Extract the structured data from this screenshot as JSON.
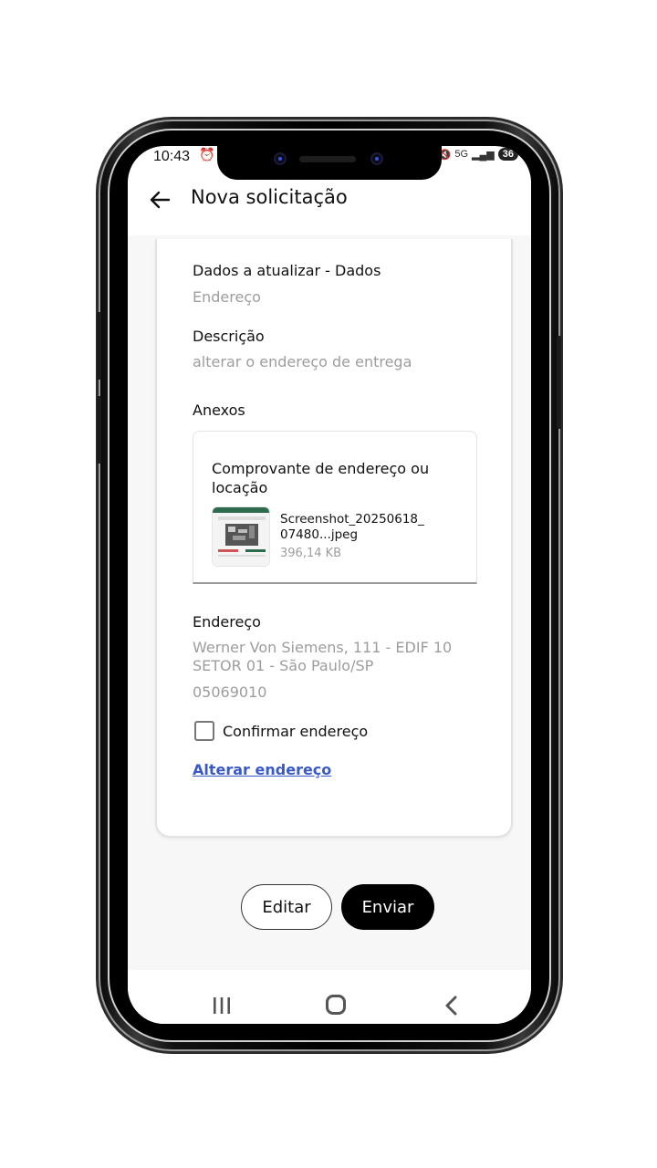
{
  "status_bar": {
    "time": "10:43",
    "network": "5G",
    "battery": "36"
  },
  "header": {
    "title": "Nova solicitação"
  },
  "form": {
    "dados_label": "Dados a atualizar - Dados",
    "dados_value": "Endereço",
    "descricao_label": "Descrição",
    "descricao_value": "alterar o endereço de entrega",
    "anexos_label": "Anexos",
    "attachment": {
      "title": "Comprovante de endereço ou locação",
      "file_name": "Screenshot_20250618_ 07480...jpeg",
      "file_size": "396,14 KB"
    },
    "endereco_label": "Endereço",
    "endereco_line": "Werner Von Siemens, 111 - EDIF 10 SETOR 01 - São Paulo/SP",
    "cep": "05069010",
    "confirm_label": "Confirmar endereço",
    "confirm_checked": false,
    "change_link": "Alterar endereço"
  },
  "actions": {
    "edit_label": "Editar",
    "send_label": "Enviar"
  },
  "colors": {
    "link": "#3a59c9",
    "muted_text": "#9d9d9d",
    "primary_button": "#000000"
  }
}
